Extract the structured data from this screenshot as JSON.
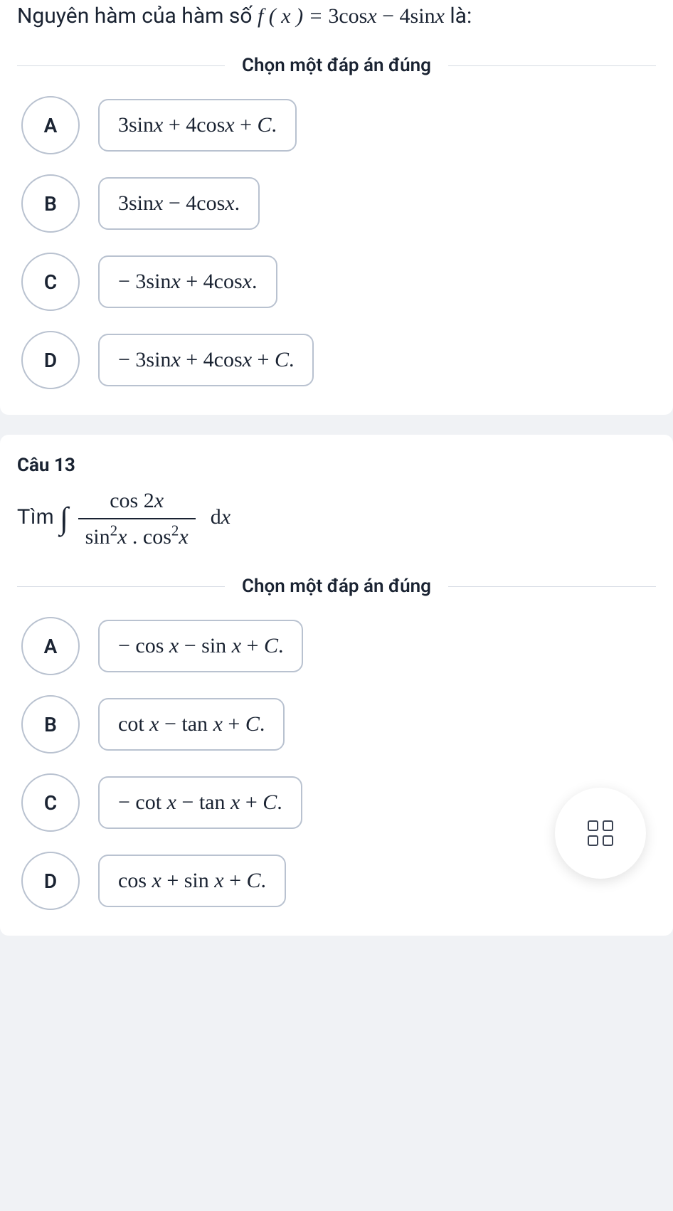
{
  "q12": {
    "prompt_prefix": "Nguyên hàm của hàm số ",
    "prompt_fn_lhs": "f ( x ) = ",
    "prompt_fn_rhs": "3cosx − 4sinx",
    "prompt_suffix": " là:",
    "divider": "Chọn một đáp án đúng",
    "options": {
      "A": {
        "letter": "A",
        "text": "3sinx + 4cosx + C."
      },
      "B": {
        "letter": "B",
        "text": "3sinx − 4cosx."
      },
      "C": {
        "letter": "C",
        "text": "− 3sinx + 4cosx."
      },
      "D": {
        "letter": "D",
        "text": "− 3sinx + 4cosx + C."
      }
    }
  },
  "q13": {
    "label": "Câu 13",
    "prompt_find": "Tìm  ",
    "frac_num": "cos 2x",
    "frac_den_sin": "sin",
    "frac_den_cos": "cos",
    "frac_den_var": "x",
    "frac_den_dot": " . ",
    "frac_den_exp": "2",
    "dx": "dx",
    "divider": "Chọn một đáp án đúng",
    "options": {
      "A": {
        "letter": "A",
        "text": "− cos x − sin x + C."
      },
      "B": {
        "letter": "B",
        "text": "cot x − tan x + C."
      },
      "C": {
        "letter": "C",
        "text": "− cot x − tan x + C."
      },
      "D": {
        "letter": "D",
        "text": "cos x + sin x + C."
      }
    }
  },
  "fab": {
    "icon": "grid-icon"
  }
}
